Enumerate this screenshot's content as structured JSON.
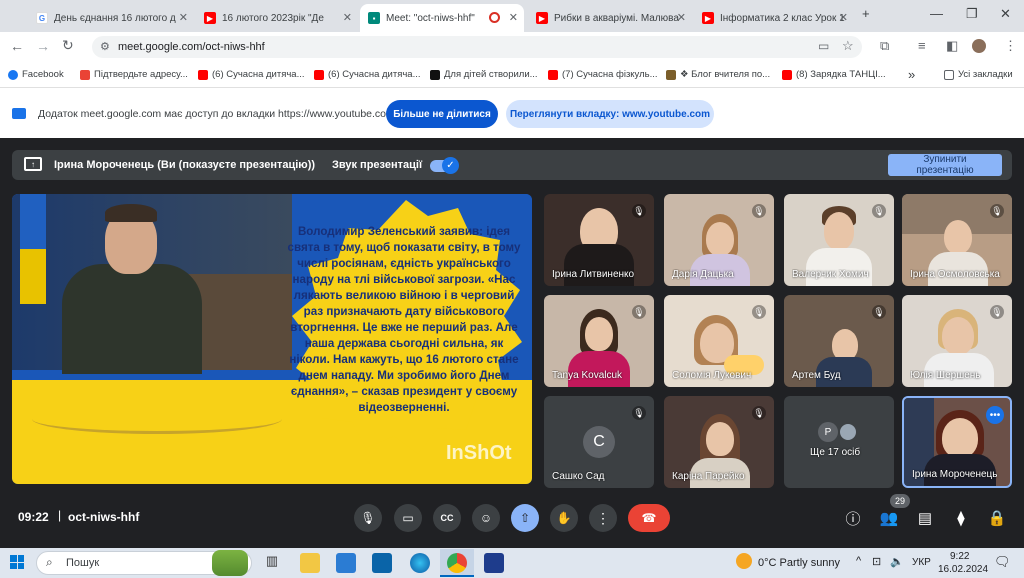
{
  "tabs": [
    {
      "label": "День єднання 16 лютого д",
      "icon": "google"
    },
    {
      "label": "16 лютого 2023рік \"Де",
      "icon": "youtube"
    },
    {
      "label": "Meet: \"oct-niws-hhf\"",
      "icon": "meet"
    },
    {
      "label": "Рибки в акваріумі. Малюва",
      "icon": "youtube"
    },
    {
      "label": "Інформатика 2 клас Урок 1",
      "icon": "youtube"
    }
  ],
  "url": "meet.google.com/oct-niws-hhf",
  "bookmarks": [
    {
      "label": "Facebook"
    },
    {
      "label": "Підтвердьте адресу..."
    },
    {
      "label": "(6) Сучасна дитяча..."
    },
    {
      "label": "(6) Сучасна дитяча..."
    },
    {
      "label": "Для дітей створили..."
    },
    {
      "label": "(7) Сучасна фізкуль..."
    },
    {
      "label": "❖ Блог вчителя по..."
    },
    {
      "label": "(8) Зарядка ТАНЦІ..."
    },
    {
      "label": "Усі закладки"
    }
  ],
  "sharebar": {
    "text": "Додаток meet.google.com має доступ до вкладки https://www.youtube.com",
    "stop_sharing": "Більше не ділитися",
    "view_tab": "Переглянути вкладку: www.youtube.com"
  },
  "presbar": {
    "presenter": "Ірина Мороченець (Ви (показуєте презентацію))",
    "sound_label": "Звук презентації",
    "stop_line1": "Зупинити",
    "stop_line2": "презентацію"
  },
  "slide": {
    "text": "Володимир Зеленський заявив: ідея свята в тому, щоб показати світу, в тому числі росіянам, єдність українського народу на тлі військової загрози. «Нас лякають великою війною і в черговий раз призначають дату військового вторгнення. Це вже не перший раз. Але наша держава сьогодні сильна, як ніколи. Нам кажуть, що 16 лютого стане днем нападу. Ми зробимо його Днем єднання», – сказав президент у своєму відеозверненні.",
    "watermark": "InShOt"
  },
  "participants": [
    {
      "name": "Ірина Литвиненко"
    },
    {
      "name": "Дарія Дацька"
    },
    {
      "name": "Валерчик Хомич"
    },
    {
      "name": "Ірина Осмоловська"
    },
    {
      "name": "Tanya Kovalcuk"
    },
    {
      "name": "Соломія Лукович"
    },
    {
      "name": "Артем Буд"
    },
    {
      "name": "Юлія Шершень"
    },
    {
      "name": "Сашко Сад",
      "initial": "С"
    },
    {
      "name": "Каріна Парейко"
    },
    {
      "name": "Ще 17 осіб",
      "initial": "Р"
    },
    {
      "name": "Ірина Мороченець"
    }
  ],
  "footer": {
    "time": "09:22",
    "code": "oct-niws-hhf",
    "people_count": "29"
  },
  "taskbar": {
    "search": "Пошук",
    "weather": "0°C  Partly sunny",
    "lang": "УКР",
    "time": "9:22",
    "date": "16.02.2024"
  },
  "colors": {
    "meet_bg": "#202124",
    "end_call": "#ea4335",
    "accent": "#1a73e8",
    "slide_yellow": "#f7d117",
    "slide_blue": "#1a57b8"
  }
}
